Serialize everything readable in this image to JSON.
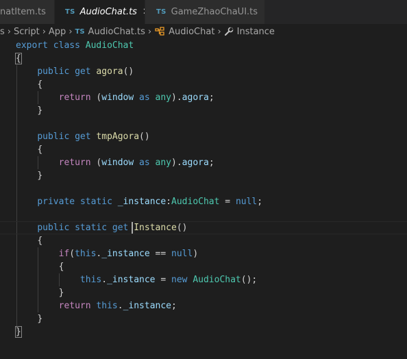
{
  "tabs": [
    {
      "icon": "",
      "label": "natItem.ts",
      "active": false
    },
    {
      "icon": "TS",
      "label": "AudioChat.ts",
      "active": true,
      "close": "✕"
    },
    {
      "icon": "TS",
      "label": "GameZhaoChaUI.ts",
      "active": false
    }
  ],
  "breadcrumb": {
    "items": [
      "s",
      "Script",
      "App",
      "AudioChat.ts",
      "AudioChat",
      "Instance"
    ],
    "ts_badge": "TS",
    "separator": "›"
  },
  "code": {
    "lines": [
      "export class AudioChat",
      "{",
      "    public get agora()",
      "    {",
      "        return (window as any).agora;",
      "    }",
      "",
      "    public get tmpAgora()",
      "    {",
      "        return (window as any).agora;",
      "    }",
      "",
      "    private static _instance:AudioChat = null;",
      "",
      "    public static get Instance()",
      "    {",
      "        if(this._instance == null)",
      "        {",
      "            this._instance = new AudioChat();",
      "        }",
      "        return this._instance;",
      "    }",
      "}"
    ]
  },
  "colors": {
    "background": "#1e1e1e",
    "keyword": "#569cd6",
    "control": "#c586c0",
    "class": "#4ec9b0",
    "function": "#dcdcaa",
    "variable": "#9cdcfe",
    "ts_icon": "#519aba"
  },
  "icons": {
    "breadcrumb_class": "class-symbol-icon",
    "breadcrumb_property": "wrench-icon"
  }
}
